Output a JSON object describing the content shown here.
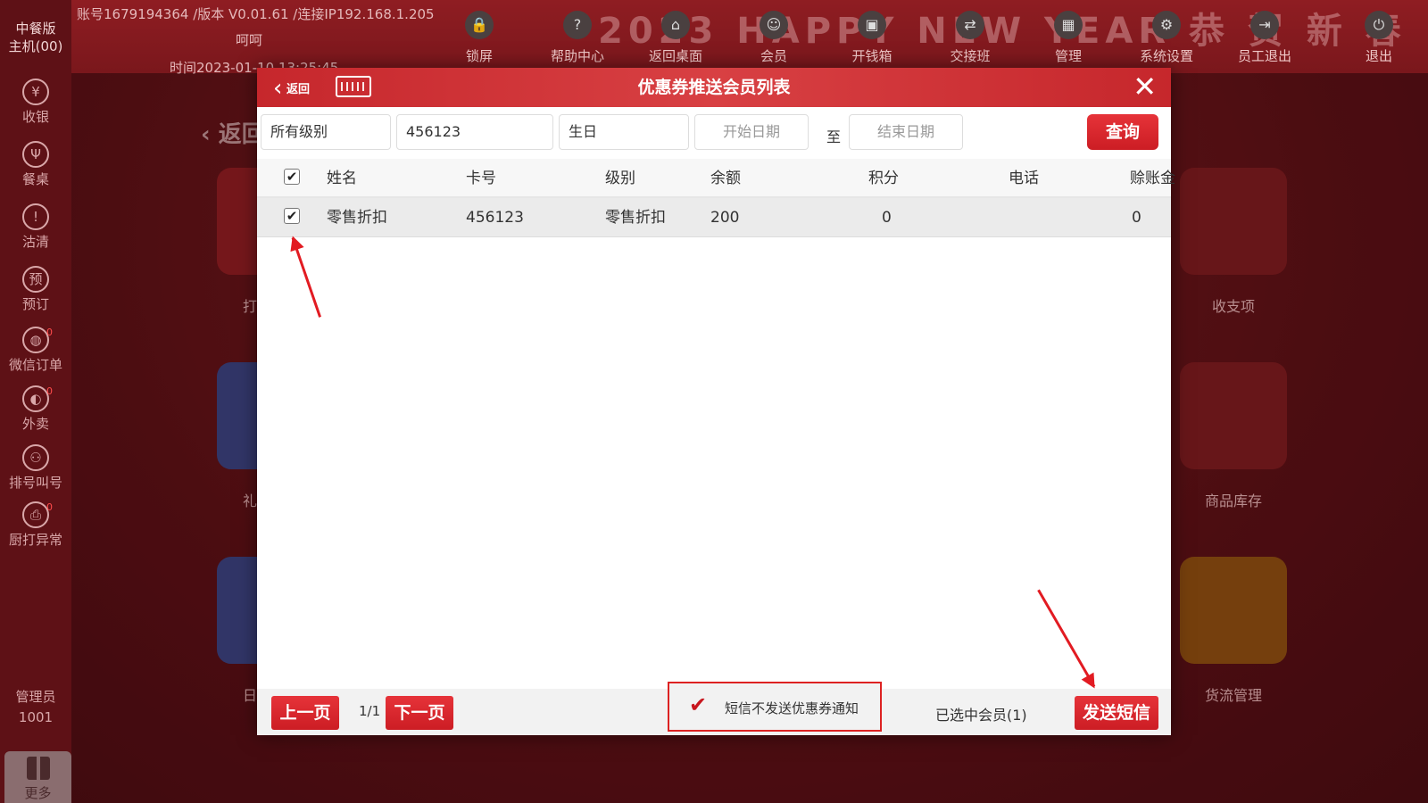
{
  "sidebar": {
    "brand_line1": "中餐版",
    "brand_line2": "主机(00)",
    "items": [
      {
        "label": "收银",
        "icon": "¥",
        "badge": ""
      },
      {
        "label": "餐桌",
        "icon": "Ψ",
        "badge": ""
      },
      {
        "label": "沽清",
        "icon": "!",
        "badge": ""
      },
      {
        "label": "预订",
        "icon": "预",
        "badge": ""
      },
      {
        "label": "微信订单",
        "icon": "◍",
        "badge": "0"
      },
      {
        "label": "外卖",
        "icon": "◐",
        "badge": "0"
      },
      {
        "label": "排号叫号",
        "icon": "⚇",
        "badge": ""
      },
      {
        "label": "厨打异常",
        "icon": "⎙",
        "badge": "0"
      }
    ],
    "user_role": "管理员",
    "user_id": "1001",
    "more_label": "更多"
  },
  "header": {
    "account": "账号1679194364 /版本 V0.01.61 /连接IP192.168.1.205",
    "user": "呵呵",
    "time": "时间2023-01-10 13:25:45",
    "banner": "2023 HAPPY NEW YEAR 恭 贺 新 春",
    "toolbar": [
      {
        "label": "锁屏",
        "icon": "lock-icon",
        "glyph": "🔒"
      },
      {
        "label": "帮助中心",
        "icon": "help-icon",
        "glyph": "?"
      },
      {
        "label": "返回桌面",
        "icon": "desktop-icon",
        "glyph": "⌂"
      },
      {
        "label": "会员",
        "icon": "member-icon",
        "glyph": "☺"
      },
      {
        "label": "开钱箱",
        "icon": "cashbox-icon",
        "glyph": "▣"
      },
      {
        "label": "交接班",
        "icon": "shift-icon",
        "glyph": "⇄"
      },
      {
        "label": "管理",
        "icon": "manage-icon",
        "glyph": "▦"
      },
      {
        "label": "系统设置",
        "icon": "gear-icon",
        "glyph": "⚙"
      },
      {
        "label": "员工退出",
        "icon": "logout-icon",
        "glyph": "⇥"
      },
      {
        "label": "退出",
        "icon": "power-icon",
        "glyph": "⏻"
      }
    ]
  },
  "background": {
    "back_label": "返回",
    "tiles_left": [
      "打",
      "礼",
      "日"
    ],
    "tiles_right": [
      "收支项",
      "商品库存",
      "货流管理"
    ]
  },
  "modal": {
    "back_label": "返回",
    "title": "优惠券推送会员列表",
    "filters": {
      "level": "所有级别",
      "card_no": "456123",
      "date_type": "生日",
      "start_placeholder": "开始日期",
      "to": "至",
      "end_placeholder": "结束日期",
      "query_label": "查询"
    },
    "table": {
      "columns": [
        "姓名",
        "卡号",
        "级别",
        "余额",
        "积分",
        "电话",
        "赊账金"
      ],
      "rows": [
        {
          "name": "零售折扣",
          "card": "456123",
          "level": "零售折扣",
          "balance": "200",
          "points": "0",
          "phone": "",
          "credit": "0",
          "checked": true
        }
      ]
    },
    "footer": {
      "prev_label": "上一页",
      "page": "1/1",
      "next_label": "下一页",
      "sms_notice": "短信不发送优惠券通知",
      "selected": "已选中会员(1)",
      "send_label": "发送短信"
    }
  },
  "colors": {
    "accent": "#d0232a",
    "header_bg": "#c6272c",
    "annotation": "#e21b22"
  }
}
